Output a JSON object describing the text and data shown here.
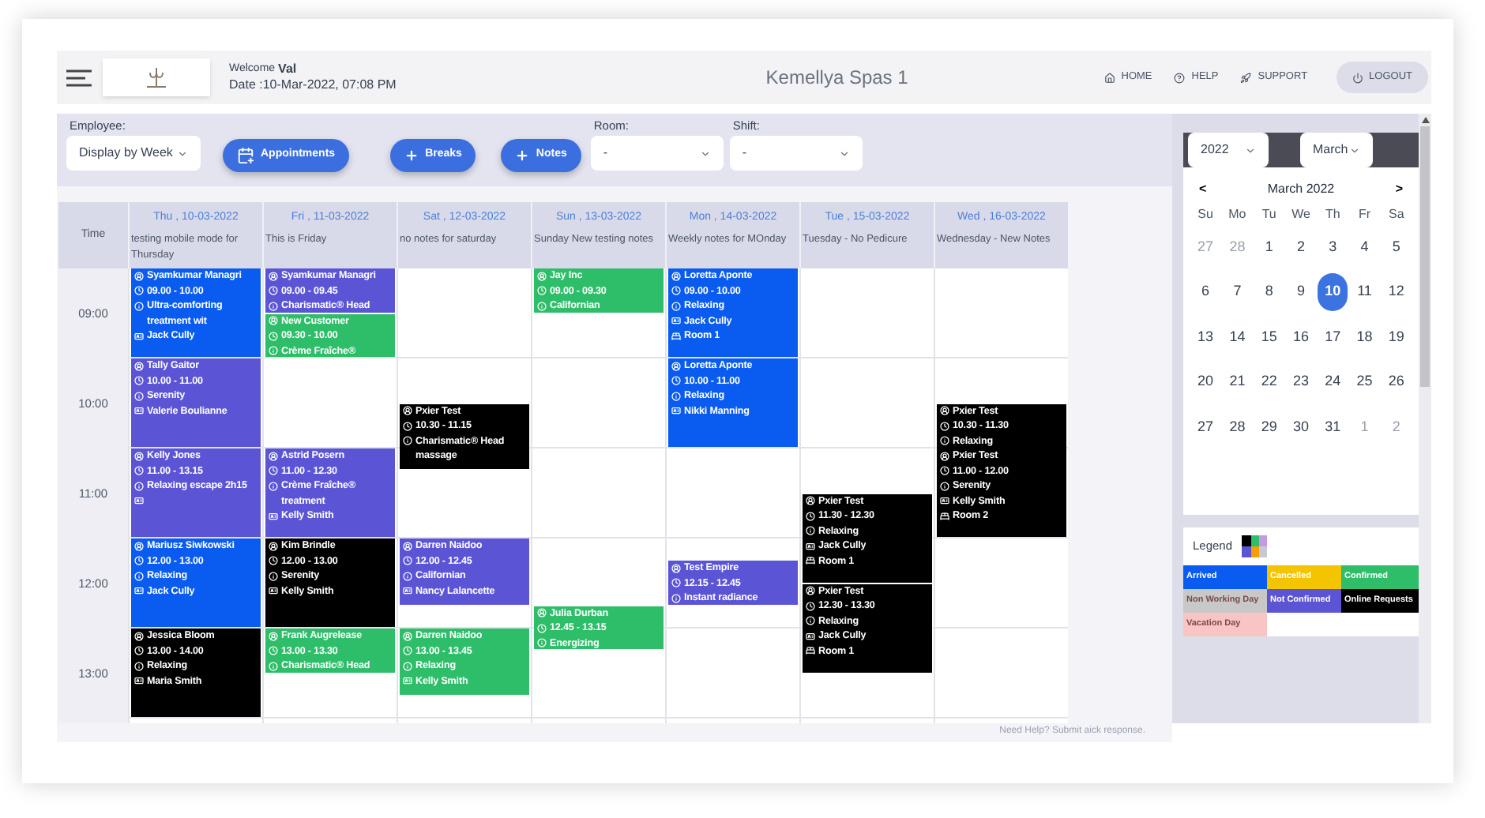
{
  "header": {
    "welcome_label": "Welcome",
    "user": "Val",
    "date": "Date :10-Mar-2022, 07:08 PM",
    "title": "Kemellya Spas 1",
    "nav": [
      {
        "kind": "home",
        "label": "HOME"
      },
      {
        "kind": "help",
        "label": "HELP"
      },
      {
        "kind": "support",
        "label": "SUPPORT"
      }
    ],
    "logout": "LOGOUT"
  },
  "toolbar": {
    "employee": {
      "label": "Employee:",
      "value": "Display by Week"
    },
    "buttons": [
      {
        "kind": "calendar",
        "label": "Appointments"
      },
      {
        "kind": "plus",
        "label": "Breaks"
      },
      {
        "kind": "plus",
        "label": "Notes"
      }
    ],
    "room": {
      "label": "Room:",
      "value": "-"
    },
    "shift": {
      "label": "Shift:",
      "value": "-"
    }
  },
  "schedule": {
    "time_heading": "Time",
    "hours": [
      "09:00",
      "10:00",
      "11:00",
      "12:00",
      "13:00"
    ],
    "days": [
      {
        "date": "Thu , 10-03-2022",
        "note": "testing mobile mode for Thursday",
        "events": [
          {
            "color": "#0a5cf0",
            "lines": [
              {
                "kind": "person",
                "text": "Syamkumar Managri"
              },
              {
                "kind": "time",
                "text": "09.00 - 10.00"
              },
              {
                "kind": "info",
                "text": "Ultra-comforting treatment wit"
              },
              {
                "kind": "card",
                "text": "Jack Cully"
              }
            ]
          },
          {
            "color": "#5b55d6",
            "lines": [
              {
                "kind": "person",
                "text": "Tally Gaitor"
              },
              {
                "kind": "time",
                "text": "10.00 - 11.00"
              },
              {
                "kind": "info",
                "text": "Serenity"
              },
              {
                "kind": "card",
                "text": "Valerie Boulianne"
              }
            ]
          },
          {
            "color": "#5b55d6",
            "lines": [
              {
                "kind": "person",
                "text": "Kelly Jones"
              },
              {
                "kind": "time",
                "text": "11.00 - 13.15"
              },
              {
                "kind": "info",
                "text": "Relaxing escape 2h15"
              },
              {
                "kind": "card"
              }
            ]
          },
          {
            "color": "#0a5cf0",
            "lines": [
              {
                "kind": "person",
                "text": "Mariusz Siwkowski"
              },
              {
                "kind": "time",
                "text": "12.00 - 13.00"
              },
              {
                "kind": "info",
                "text": "Relaxing"
              },
              {
                "kind": "card",
                "text": "Jack Cully"
              }
            ]
          },
          {
            "color": "#000000",
            "lines": [
              {
                "kind": "person",
                "text": "Jessica Bloom"
              },
              {
                "kind": "time",
                "text": "13.00 - 14.00"
              },
              {
                "kind": "info",
                "text": "Relaxing"
              },
              {
                "kind": "card",
                "text": "Maria Smith"
              }
            ]
          }
        ]
      },
      {
        "date": "Fri , 11-03-2022",
        "note": "This is Friday",
        "events": [
          {
            "color": "#5b55d6",
            "lines": [
              {
                "kind": "person",
                "text": "Syamkumar Managri"
              },
              {
                "kind": "time",
                "text": "09.00 - 09.45"
              },
              {
                "kind": "info",
                "text": "Charismatic® Head"
              }
            ]
          },
          {
            "color": "#2ebd68",
            "lines": [
              {
                "kind": "person",
                "text": "New Customer"
              },
              {
                "kind": "time",
                "text": "09.30 - 10.00"
              },
              {
                "kind": "info",
                "text": "Crème Fraîche®"
              }
            ]
          },
          {
            "color": "#5b55d6",
            "lines": [
              {
                "kind": "person",
                "text": "Astrid Posern"
              },
              {
                "kind": "time",
                "text": "11.00 - 12.30"
              },
              {
                "kind": "info",
                "text": "Crème Fraîche® treatment"
              },
              {
                "kind": "card",
                "text": "Kelly Smith"
              }
            ]
          },
          {
            "color": "#000000",
            "lines": [
              {
                "kind": "person",
                "text": "Kim Brindle"
              },
              {
                "kind": "time",
                "text": "12.00 - 13.00"
              },
              {
                "kind": "info",
                "text": "Serenity"
              },
              {
                "kind": "card",
                "text": "Kelly Smith"
              }
            ]
          },
          {
            "color": "#2ebd68",
            "lines": [
              {
                "kind": "person",
                "text": "Frank Augrelease"
              },
              {
                "kind": "time",
                "text": "13.00 - 13.30"
              },
              {
                "kind": "info",
                "text": "Charismatic® Head"
              }
            ]
          }
        ]
      },
      {
        "date": "Sat , 12-03-2022",
        "note": "no notes for saturday",
        "events": [
          {
            "color": "#000000",
            "lines": [
              {
                "kind": "person",
                "text": "Pxier Test"
              },
              {
                "kind": "time",
                "text": "10.30 - 11.15"
              },
              {
                "kind": "info",
                "text": "Charismatic® Head massage"
              }
            ]
          },
          {
            "color": "#5b55d6",
            "lines": [
              {
                "kind": "person",
                "text": "Darren Naidoo"
              },
              {
                "kind": "time",
                "text": "12.00 - 12.45"
              },
              {
                "kind": "info",
                "text": "Californian"
              },
              {
                "kind": "card",
                "text": "Nancy Lalancette"
              }
            ]
          },
          {
            "color": "#2ebd68",
            "lines": [
              {
                "kind": "person",
                "text": "Darren Naidoo"
              },
              {
                "kind": "time",
                "text": "13.00 - 13.45"
              },
              {
                "kind": "info",
                "text": "Relaxing"
              },
              {
                "kind": "card",
                "text": "Kelly Smith"
              }
            ]
          }
        ]
      },
      {
        "date": "Sun , 13-03-2022",
        "note": "Sunday New testing notes",
        "events": [
          {
            "color": "#2ebd68",
            "lines": [
              {
                "kind": "person",
                "text": "Jay Inc"
              },
              {
                "kind": "time",
                "text": "09.00 - 09.30"
              },
              {
                "kind": "info",
                "text": "Californian"
              }
            ]
          },
          {
            "color": "#2ebd68",
            "lines": [
              {
                "kind": "person",
                "text": "Julia Durban"
              },
              {
                "kind": "time",
                "text": "12.45 - 13.15"
              },
              {
                "kind": "info",
                "text": "Energizing"
              }
            ]
          }
        ]
      },
      {
        "date": "Mon , 14-03-2022",
        "note": "Weekly notes for MOnday",
        "events": [
          {
            "color": "#0a5cf0",
            "lines": [
              {
                "kind": "person",
                "text": "Loretta Aponte"
              },
              {
                "kind": "time",
                "text": "09.00 - 10.00"
              },
              {
                "kind": "info",
                "text": "Relaxing"
              },
              {
                "kind": "card",
                "text": "Jack Cully"
              },
              {
                "kind": "room",
                "text": "Room 1"
              }
            ]
          },
          {
            "color": "#0a5cf0",
            "lines": [
              {
                "kind": "person",
                "text": "Loretta Aponte"
              },
              {
                "kind": "time",
                "text": "10.00 - 11.00"
              },
              {
                "kind": "info",
                "text": "Relaxing"
              },
              {
                "kind": "card",
                "text": "Nikki Manning"
              }
            ]
          },
          {
            "color": "#5b55d6",
            "lines": [
              {
                "kind": "person",
                "text": "Test Empire"
              },
              {
                "kind": "time",
                "text": "12.15 - 12.45"
              },
              {
                "kind": "info",
                "text": "Instant radiance"
              }
            ]
          }
        ]
      },
      {
        "date": "Tue , 15-03-2022",
        "note": "Tuesday - No Pedicure",
        "events": [
          {
            "color": "#000000",
            "lines": [
              {
                "kind": "person",
                "text": "Pxier Test"
              },
              {
                "kind": "time",
                "text": "11.30 - 12.30"
              },
              {
                "kind": "info",
                "text": "Relaxing"
              },
              {
                "kind": "card",
                "text": "Jack Cully"
              },
              {
                "kind": "room",
                "text": "Room 1"
              }
            ]
          },
          {
            "color": "#000000",
            "lines": [
              {
                "kind": "person",
                "text": "Pxier Test"
              },
              {
                "kind": "time",
                "text": "12.30 - 13.30"
              },
              {
                "kind": "info",
                "text": "Relaxing"
              },
              {
                "kind": "card",
                "text": "Jack Cully"
              },
              {
                "kind": "room",
                "text": "Room 1"
              }
            ]
          }
        ]
      },
      {
        "date": "Wed , 16-03-2022",
        "note": "Wednesday - New Notes",
        "events": [
          {
            "color": "#000000",
            "lines": [
              {
                "kind": "person",
                "text": "Pxier Test"
              },
              {
                "kind": "time",
                "text": "10.30 - 11.30"
              },
              {
                "kind": "info",
                "text": "Relaxing"
              },
              {
                "kind": "person",
                "text": "Pxier Test"
              },
              {
                "kind": "time",
                "text": "11.00 - 12.00"
              },
              {
                "kind": "info",
                "text": "Serenity"
              },
              {
                "kind": "card",
                "text": "Kelly Smith"
              },
              {
                "kind": "room",
                "text": "Room 2"
              }
            ]
          }
        ]
      }
    ]
  },
  "mini_calendar": {
    "year": "2022",
    "month": "March",
    "title": "March 2022",
    "prev": "<",
    "next": ">",
    "weekdays": [
      "Su",
      "Mo",
      "Tu",
      "We",
      "Th",
      "Fr",
      "Sa"
    ],
    "weeks": [
      [
        {
          "day": "27",
          "outside": true,
          "selected": false
        },
        {
          "day": "28",
          "outside": true,
          "selected": false
        },
        {
          "day": "1",
          "outside": false,
          "selected": false
        },
        {
          "day": "2",
          "outside": false,
          "selected": false
        },
        {
          "day": "3",
          "outside": false,
          "selected": false
        },
        {
          "day": "4",
          "outside": false,
          "selected": false
        },
        {
          "day": "5",
          "outside": false,
          "selected": false
        }
      ],
      [
        {
          "day": "6",
          "outside": false,
          "selected": false
        },
        {
          "day": "7",
          "outside": false,
          "selected": false
        },
        {
          "day": "8",
          "outside": false,
          "selected": false
        },
        {
          "day": "9",
          "outside": false,
          "selected": false
        },
        {
          "day": "10",
          "outside": false,
          "selected": true
        },
        {
          "day": "11",
          "outside": false,
          "selected": false
        },
        {
          "day": "12",
          "outside": false,
          "selected": false
        }
      ],
      [
        {
          "day": "13",
          "outside": false,
          "selected": false
        },
        {
          "day": "14",
          "outside": false,
          "selected": false
        },
        {
          "day": "15",
          "outside": false,
          "selected": false
        },
        {
          "day": "16",
          "outside": false,
          "selected": false
        },
        {
          "day": "17",
          "outside": false,
          "selected": false
        },
        {
          "day": "18",
          "outside": false,
          "selected": false
        },
        {
          "day": "19",
          "outside": false,
          "selected": false
        }
      ],
      [
        {
          "day": "20",
          "outside": false,
          "selected": false
        },
        {
          "day": "21",
          "outside": false,
          "selected": false
        },
        {
          "day": "22",
          "outside": false,
          "selected": false
        },
        {
          "day": "23",
          "outside": false,
          "selected": false
        },
        {
          "day": "24",
          "outside": false,
          "selected": false
        },
        {
          "day": "25",
          "outside": false,
          "selected": false
        },
        {
          "day": "26",
          "outside": false,
          "selected": false
        }
      ],
      [
        {
          "day": "27",
          "outside": false,
          "selected": false
        },
        {
          "day": "28",
          "outside": false,
          "selected": false
        },
        {
          "day": "29",
          "outside": false,
          "selected": false
        },
        {
          "day": "30",
          "outside": false,
          "selected": false
        },
        {
          "day": "31",
          "outside": false,
          "selected": false
        },
        {
          "day": "1",
          "outside": true,
          "selected": false
        },
        {
          "day": "2",
          "outside": true,
          "selected": false
        }
      ]
    ]
  },
  "legend": {
    "title": "Legend",
    "items": [
      {
        "label": "Arrived",
        "color": "#0a5cf0"
      },
      {
        "label": "Cancelled",
        "color": "#f5c400"
      },
      {
        "label": "Confirmed",
        "color": "#2ebd68"
      },
      {
        "label": "Non Working Day",
        "color": "#c8c8c8"
      },
      {
        "label": "Not Confirmed",
        "color": "#5b55d6"
      },
      {
        "label": "Online Requests",
        "color": "#000000"
      },
      {
        "label": "Vacation Day",
        "color": "#f8c4c4"
      }
    ]
  },
  "footer": "Need Help? Submit aick response."
}
